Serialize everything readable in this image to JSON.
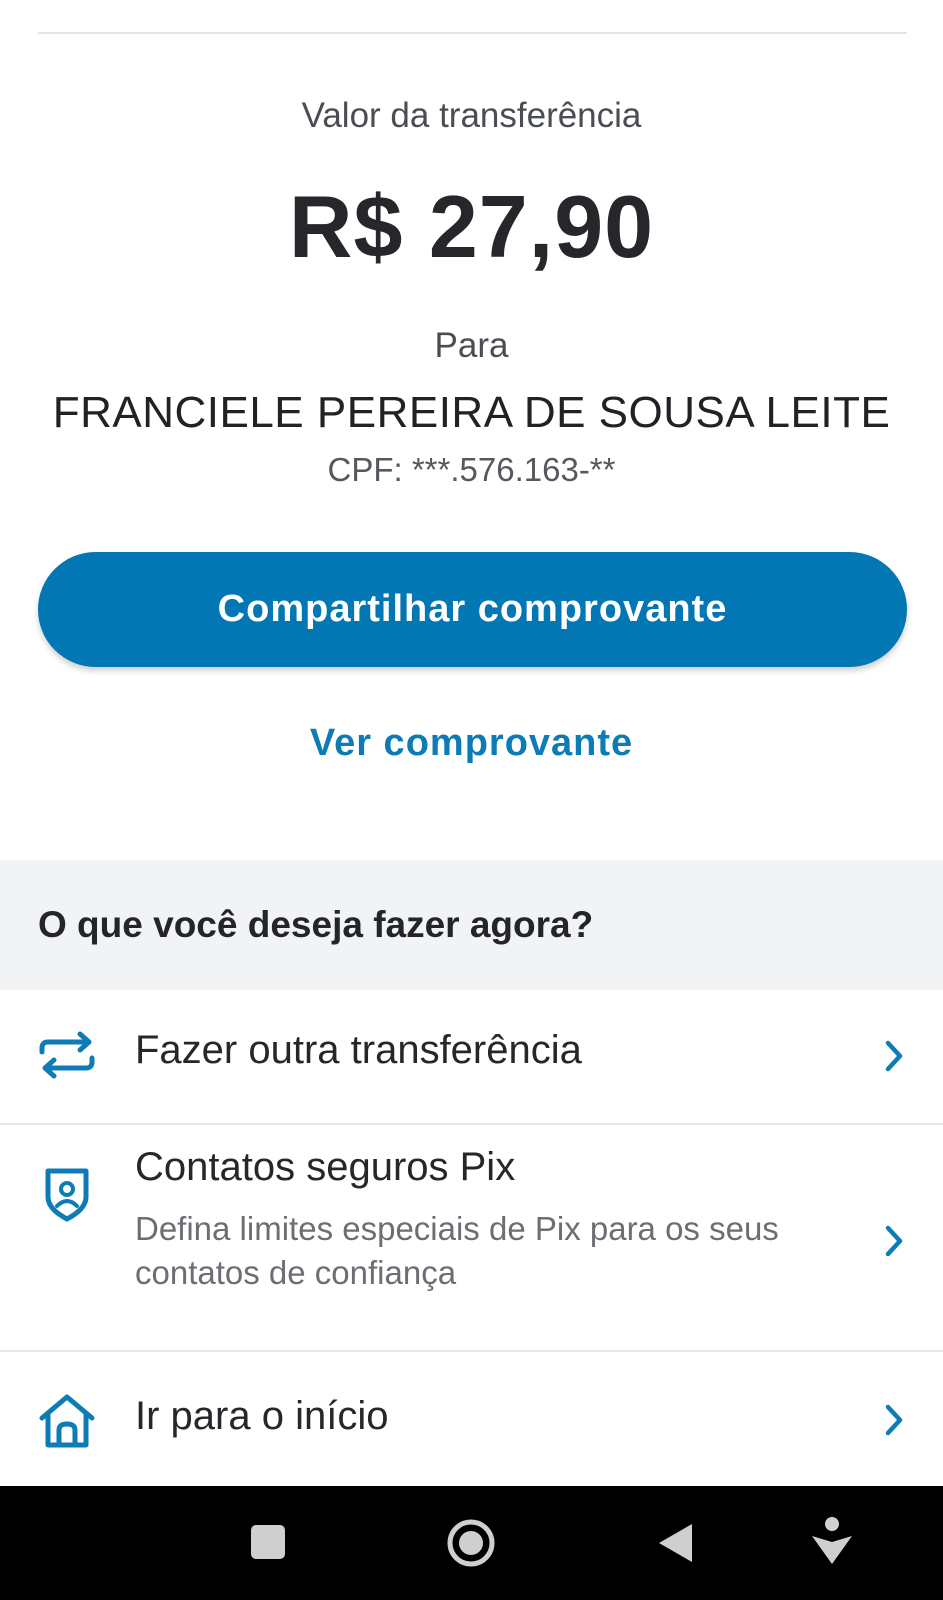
{
  "transfer": {
    "amount_label": "Valor da transferência",
    "amount": "R$ 27,90",
    "to_label": "Para",
    "recipient_name": "FRANCIELE PEREIRA DE SOUSA LEITE",
    "recipient_doc": "CPF: ***.576.163-**"
  },
  "buttons": {
    "share_label": "Compartilhar comprovante",
    "view_label": "Ver comprovante"
  },
  "next_actions": {
    "header": "O que você deseja fazer agora?",
    "items": [
      {
        "title": "Fazer outra transferência",
        "subtitle": "",
        "icon": "transfer-arrows-icon"
      },
      {
        "title": "Contatos seguros Pix",
        "subtitle": "Defina limites especiais de Pix para os seus contatos de confiança",
        "icon": "shield-user-icon"
      },
      {
        "title": "Ir para o início",
        "subtitle": "",
        "icon": "home-icon"
      }
    ]
  },
  "system_nav": {
    "buttons": [
      "recents-square-icon",
      "home-circle-icon",
      "back-triangle-icon",
      "accessibility-icon"
    ]
  },
  "colors": {
    "primary": "#0277b3",
    "link": "#0d7bb5",
    "section_bg": "#f2f3f5",
    "nav_bg": "#000000"
  }
}
